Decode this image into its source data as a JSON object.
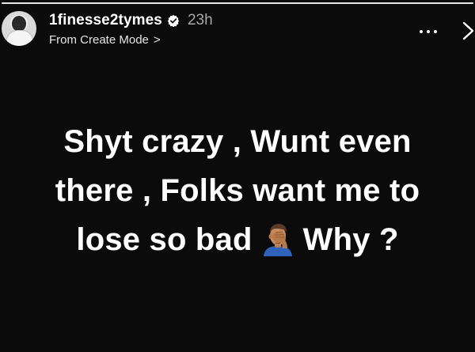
{
  "story": {
    "progress": 1.0,
    "username": "1finesse2tymes",
    "verified": true,
    "timestamp": "23h",
    "source_label": "From Create Mode",
    "source_chevron": ">"
  },
  "caption": {
    "line1": "Shyt crazy , Wunt even",
    "line2": "there , Folks want me to",
    "line3_before": "lose so bad",
    "line3_emoji": "face-palm-emoji",
    "line3_after": "Why ?"
  },
  "icons": {
    "verified": "verified-badge-icon",
    "more": "more-options-icon",
    "close": "close-icon"
  },
  "colors": {
    "background": "#0b0b0b",
    "text": "#ffffff",
    "secondary": "#a8a8a8"
  }
}
